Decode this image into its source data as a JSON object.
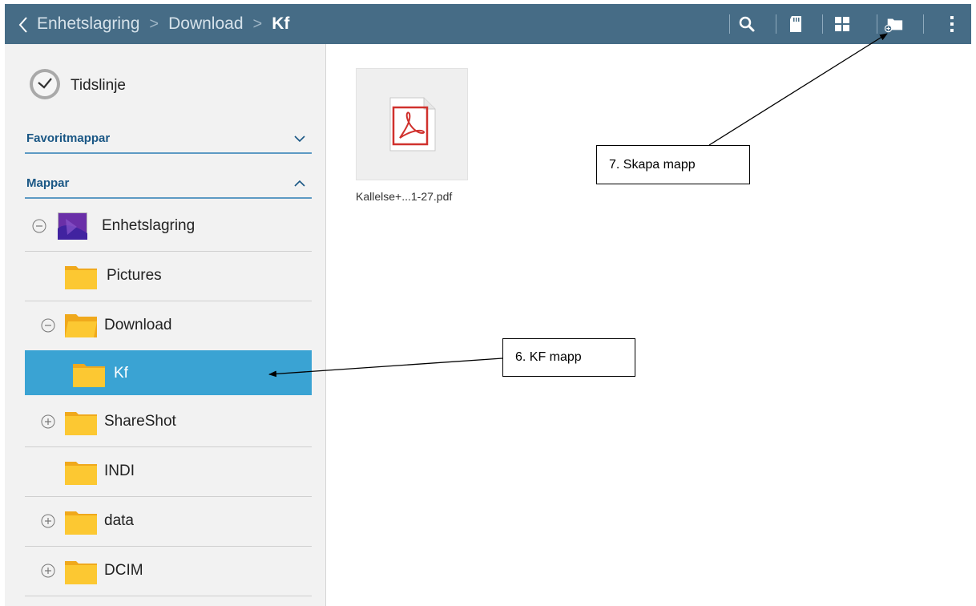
{
  "header": {
    "breadcrumbs": [
      "Enhetslagring",
      "Download",
      "Kf"
    ],
    "toolbar": [
      "search-icon",
      "sd-card-icon",
      "grid-view-icon",
      "new-folder-icon",
      "more-vert-icon"
    ]
  },
  "sidebar": {
    "timeline_label": "Tidslinje",
    "favorites_title": "Favoritmappar",
    "folders_title": "Mappar",
    "tree": {
      "storage": "Enhetslagring",
      "pictures": "Pictures",
      "download": "Download",
      "kf": "Kf",
      "shareshot": "ShareShot",
      "indi": "INDI",
      "data": "data",
      "dcim": "DCIM"
    }
  },
  "content": {
    "files": [
      {
        "name": "Kallelse+...1-27.pdf",
        "icon": "pdf-icon"
      }
    ]
  },
  "annotations": {
    "kf_callout": "6. KF mapp",
    "new_folder_callout": "7. Skapa mapp"
  },
  "colors": {
    "header_bg": "#466c86",
    "selected_row": "#3aa3d3",
    "section_title": "#1a5785",
    "folder": "#fbc531",
    "pdf_red": "#d0312d"
  }
}
